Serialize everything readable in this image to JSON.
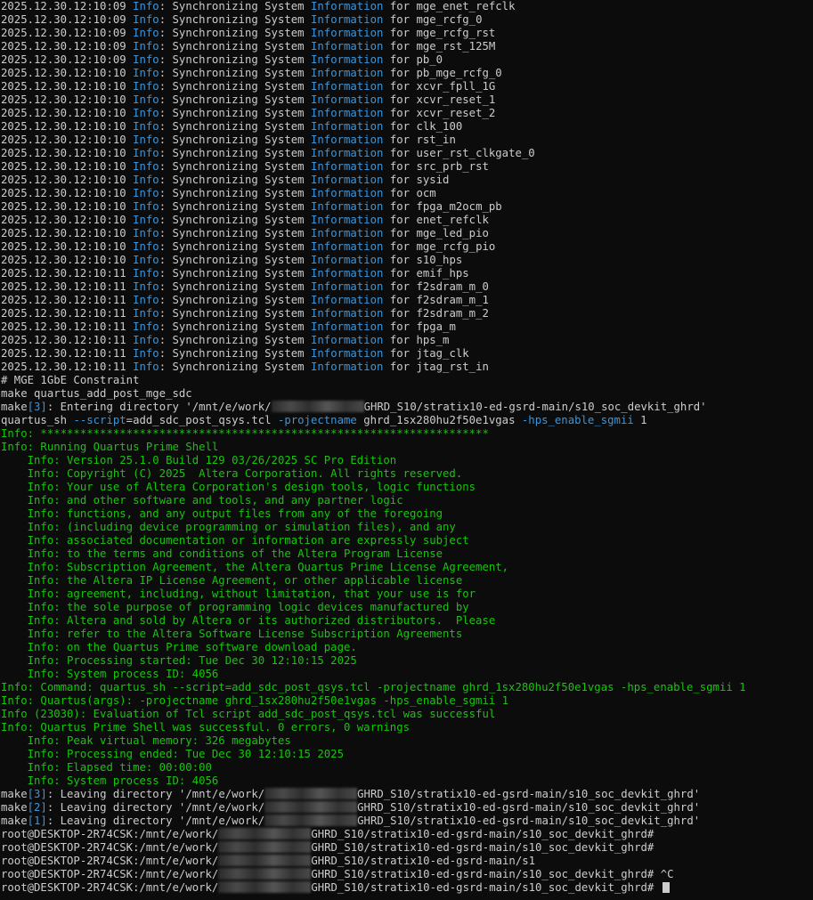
{
  "terminal": {
    "background": "#0c0c0c",
    "colors": {
      "w": "#cccccc",
      "b": "#3a96dd",
      "g": "#16c60c"
    },
    "sync_entries": [
      {
        "ts": "2025.12.30.12:10:09",
        "name": "mge_enet_refclk"
      },
      {
        "ts": "2025.12.30.12:10:09",
        "name": "mge_rcfg_0"
      },
      {
        "ts": "2025.12.30.12:10:09",
        "name": "mge_rcfg_rst"
      },
      {
        "ts": "2025.12.30.12:10:09",
        "name": "mge_rst_125M"
      },
      {
        "ts": "2025.12.30.12:10:09",
        "name": "pb_0"
      },
      {
        "ts": "2025.12.30.12:10:10",
        "name": "pb_mge_rcfg_0"
      },
      {
        "ts": "2025.12.30.12:10:10",
        "name": "xcvr_fpll_1G"
      },
      {
        "ts": "2025.12.30.12:10:10",
        "name": "xcvr_reset_1"
      },
      {
        "ts": "2025.12.30.12:10:10",
        "name": "xcvr_reset_2"
      },
      {
        "ts": "2025.12.30.12:10:10",
        "name": "clk_100"
      },
      {
        "ts": "2025.12.30.12:10:10",
        "name": "rst_in"
      },
      {
        "ts": "2025.12.30.12:10:10",
        "name": "user_rst_clkgate_0"
      },
      {
        "ts": "2025.12.30.12:10:10",
        "name": "src_prb_rst"
      },
      {
        "ts": "2025.12.30.12:10:10",
        "name": "sysid"
      },
      {
        "ts": "2025.12.30.12:10:10",
        "name": "ocm"
      },
      {
        "ts": "2025.12.30.12:10:10",
        "name": "fpga_m2ocm_pb"
      },
      {
        "ts": "2025.12.30.12:10:10",
        "name": "enet_refclk"
      },
      {
        "ts": "2025.12.30.12:10:10",
        "name": "mge_led_pio"
      },
      {
        "ts": "2025.12.30.12:10:10",
        "name": "mge_rcfg_pio"
      },
      {
        "ts": "2025.12.30.12:10:10",
        "name": "s10_hps"
      },
      {
        "ts": "2025.12.30.12:10:11",
        "name": "emif_hps"
      },
      {
        "ts": "2025.12.30.12:10:11",
        "name": "f2sdram_m_0"
      },
      {
        "ts": "2025.12.30.12:10:11",
        "name": "f2sdram_m_1"
      },
      {
        "ts": "2025.12.30.12:10:11",
        "name": "f2sdram_m_2"
      },
      {
        "ts": "2025.12.30.12:10:11",
        "name": "fpga_m"
      },
      {
        "ts": "2025.12.30.12:10:11",
        "name": "hps_m"
      },
      {
        "ts": "2025.12.30.12:10:11",
        "name": "jtag_clk"
      },
      {
        "ts": "2025.12.30.12:10:11",
        "name": "jtag_rst_in"
      }
    ],
    "tail_lines": [
      [
        [
          "w",
          "# MGE 1GbE Constraint"
        ]
      ],
      [
        [
          "w",
          "make quartus_add_post_mge_sdc"
        ]
      ],
      [
        [
          "w",
          "make"
        ],
        [
          "b",
          "[3]"
        ],
        [
          "w",
          ": Entering directory '/mnt/e/work/"
        ],
        [
          "blur",
          "",
          104
        ],
        [
          "w",
          "GHRD_S10/stratix10-ed-gsrd-main/s10_soc_devkit_ghrd'"
        ]
      ],
      [
        [
          "w",
          "quartus_sh "
        ],
        [
          "b",
          "--script"
        ],
        [
          "w",
          "=add_sdc_post_qsys.tcl "
        ],
        [
          "b",
          "-projectname"
        ],
        [
          "w",
          " ghrd_1sx280hu2f50e1vgas "
        ],
        [
          "b",
          "-hps_enable_sgmii"
        ],
        [
          "w",
          " 1"
        ]
      ],
      [
        [
          "g",
          "Info: ********************************************************************"
        ]
      ],
      [
        [
          "g",
          "Info: Running Quartus Prime Shell"
        ]
      ],
      [
        [
          "g",
          "    Info: Version 25.1.0 Build 129 03/26/2025 SC Pro Edition"
        ]
      ],
      [
        [
          "g",
          "    Info: Copyright (C) 2025  Altera Corporation. All rights reserved."
        ]
      ],
      [
        [
          "g",
          "    Info: Your use of Altera Corporation's design tools, logic functions"
        ]
      ],
      [
        [
          "g",
          "    Info: and other software and tools, and any partner logic"
        ]
      ],
      [
        [
          "g",
          "    Info: functions, and any output files from any of the foregoing"
        ]
      ],
      [
        [
          "g",
          "    Info: (including device programming or simulation files), and any"
        ]
      ],
      [
        [
          "g",
          "    Info: associated documentation or information are expressly subject"
        ]
      ],
      [
        [
          "g",
          "    Info: to the terms and conditions of the Altera Program License"
        ]
      ],
      [
        [
          "g",
          "    Info: Subscription Agreement, the Altera Quartus Prime License Agreement,"
        ]
      ],
      [
        [
          "g",
          "    Info: the Altera IP License Agreement, or other applicable license"
        ]
      ],
      [
        [
          "g",
          "    Info: agreement, including, without limitation, that your use is for"
        ]
      ],
      [
        [
          "g",
          "    Info: the sole purpose of programming logic devices manufactured by"
        ]
      ],
      [
        [
          "g",
          "    Info: Altera and sold by Altera or its authorized distributors.  Please"
        ]
      ],
      [
        [
          "g",
          "    Info: refer to the Altera Software License Subscription Agreements"
        ]
      ],
      [
        [
          "g",
          "    Info: on the Quartus Prime software download page."
        ]
      ],
      [
        [
          "g",
          "    Info: Processing started: Tue Dec 30 12:10:15 2025"
        ]
      ],
      [
        [
          "g",
          "    Info: System process ID: 4056"
        ]
      ],
      [
        [
          "g",
          "Info: Command: quartus_sh --script=add_sdc_post_qsys.tcl -projectname ghrd_1sx280hu2f50e1vgas -hps_enable_sgmii 1"
        ]
      ],
      [
        [
          "g",
          "Info: Quartus(args): -projectname ghrd_1sx280hu2f50e1vgas -hps_enable_sgmii 1"
        ]
      ],
      [
        [
          "g",
          "Info (23030): Evaluation of Tcl script add_sdc_post_qsys.tcl was successful"
        ]
      ],
      [
        [
          "g",
          "Info: Quartus Prime Shell was successful. 0 errors, 0 warnings"
        ]
      ],
      [
        [
          "g",
          "    Info: Peak virtual memory: 326 megabytes"
        ]
      ],
      [
        [
          "g",
          "    Info: Processing ended: Tue Dec 30 12:10:15 2025"
        ]
      ],
      [
        [
          "g",
          "    Info: Elapsed time: 00:00:00"
        ]
      ],
      [
        [
          "g",
          "    Info: System process ID: 4056"
        ]
      ],
      [
        [
          "w",
          "make"
        ],
        [
          "b",
          "[3]"
        ],
        [
          "w",
          ": Leaving directory '/mnt/e/work/"
        ],
        [
          "blur",
          "",
          104
        ],
        [
          "w",
          "GHRD_S10/stratix10-ed-gsrd-main/s10_soc_devkit_ghrd'"
        ]
      ],
      [
        [
          "w",
          "make"
        ],
        [
          "b",
          "[2]"
        ],
        [
          "w",
          ": Leaving directory '/mnt/e/work/"
        ],
        [
          "blur",
          "",
          104
        ],
        [
          "w",
          "GHRD_S10/stratix10-ed-gsrd-main/s10_soc_devkit_ghrd'"
        ]
      ],
      [
        [
          "w",
          "make"
        ],
        [
          "b",
          "[1]"
        ],
        [
          "w",
          ": Leaving directory '/mnt/e/work/"
        ],
        [
          "blur",
          "",
          104
        ],
        [
          "w",
          "GHRD_S10/stratix10-ed-gsrd-main/s10_soc_devkit_ghrd'"
        ]
      ],
      [
        [
          "w",
          "root@DESKTOP-2R74CSK:/mnt/e/work/"
        ],
        [
          "blur",
          "",
          104
        ],
        [
          "w",
          "GHRD_S10/stratix10-ed-gsrd-main/s10_soc_devkit_ghrd#"
        ]
      ],
      [
        [
          "w",
          "root@DESKTOP-2R74CSK:/mnt/e/work/"
        ],
        [
          "blur",
          "",
          104
        ],
        [
          "w",
          "GHRD_S10/stratix10-ed-gsrd-main/s10_soc_devkit_ghrd#"
        ]
      ],
      [
        [
          "w",
          "root@DESKTOP-2R74CSK:/mnt/e/work/"
        ],
        [
          "blur",
          "",
          104
        ],
        [
          "w",
          "GHRD_S10/stratix10-ed-gsrd-main/s1"
        ]
      ],
      [
        [
          "w",
          "root@DESKTOP-2R74CSK:/mnt/e/work/"
        ],
        [
          "blur",
          "",
          104
        ],
        [
          "w",
          "GHRD_S10/stratix10-ed-gsrd-main/s10_soc_devkit_ghrd# ^C"
        ]
      ],
      [
        [
          "w",
          "root@DESKTOP-2R74CSK:/mnt/e/work/"
        ],
        [
          "blur",
          "",
          104
        ],
        [
          "w",
          "GHRD_S10/stratix10-ed-gsrd-main/s10_soc_devkit_ghrd# "
        ],
        [
          "cursor",
          ""
        ]
      ]
    ]
  }
}
